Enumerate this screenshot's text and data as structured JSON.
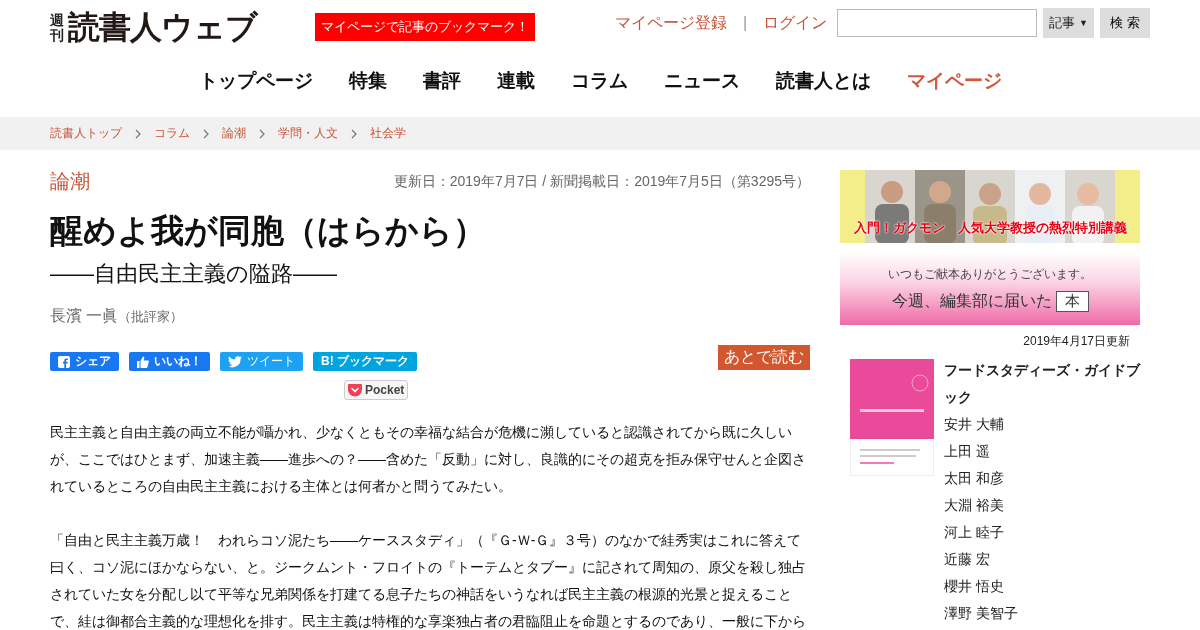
{
  "header": {
    "logo_small": "週刊",
    "logo": "読書人ウェブ",
    "promo": "マイページで記事のブックマーク！",
    "links": [
      "マイページ登録",
      "ログイン"
    ],
    "separator": "|",
    "search": {
      "scope": "記事",
      "caret": "▼",
      "button": "検 索"
    }
  },
  "nav": [
    {
      "label": "トップページ",
      "selected": false
    },
    {
      "label": "特集",
      "selected": false
    },
    {
      "label": "書評",
      "selected": false
    },
    {
      "label": "連載",
      "selected": false
    },
    {
      "label": "コラム",
      "selected": false
    },
    {
      "label": "ニュース",
      "selected": false
    },
    {
      "label": "読書人とは",
      "selected": false
    },
    {
      "label": "マイページ",
      "selected": true
    }
  ],
  "breadcrumb": [
    "読書人トップ",
    "コラム",
    "論潮",
    "学問・人文",
    "社会学"
  ],
  "article": {
    "category": "論潮",
    "dates": "更新日：2019年7月7日 / 新聞掲載日：2019年7月5日（第3295号）",
    "title": "醒めよ我が同胞（はらから）",
    "subtitle": "――自由民主主義の隘路――",
    "author": "長濱 一眞",
    "author_role": "（批評家）",
    "share": [
      {
        "kind": "facebook",
        "label": "シェア"
      },
      {
        "kind": "like",
        "label": "いいね！"
      },
      {
        "kind": "twitter",
        "label": "ツイート"
      },
      {
        "kind": "hatena",
        "label": "B! ブックマーク"
      }
    ],
    "pocket": "Pocket",
    "read_later": "あとで読む",
    "paragraphs": [
      "民主主義と自由主義の両立不能が囁かれ、少なくともその幸福な結合が危機に瀕していると認識されてから既に久しいが、ここではひとまず、加速主義――進歩への？――含めた「反動」に対し、良識的にその超克を拒み保守せんと企図されているところの自由民主主義における主体とは何者かと問うてみたい。",
      "「自由と民主主義万歳！　われらコソ泥たち――ケーススタディ」（『Ｇ-Ｗ-Ｇ』３号）のなかで絓秀実はこれに答えて曰く、コソ泥にほかならない、と。ジークムント・フロイトの『トーテムとタブー』に記されて周知の、原父を殺し独占されていた女を分配し以て平等な兄弟関係を打建てる息子たちの神話をいうなれば民主主義の根源的光景と捉えることで、絓は御都合主義的な理想化を排す。民主主義は特権的な享楽独占者の君臨阻止を命題とするのであり、一般に下から"
    ]
  },
  "sidebar": {
    "banner1": "入門！ガクモン　人気大学教授の熱烈特別講義",
    "banner2_top": "いつもご献本ありがとうございます。",
    "banner2_main": "今週、編集部に届いた",
    "banner2_book": "本",
    "updated": "2019年4月17日更新",
    "book": {
      "title": "フードスタディーズ・ガイドブック",
      "authors": [
        "安井 大輔",
        "上田 遥",
        "太田 和彦",
        "大淵 裕美",
        "河上 睦子",
        "近藤 宏",
        "櫻井 悟史",
        "澤野 美智子"
      ]
    }
  }
}
